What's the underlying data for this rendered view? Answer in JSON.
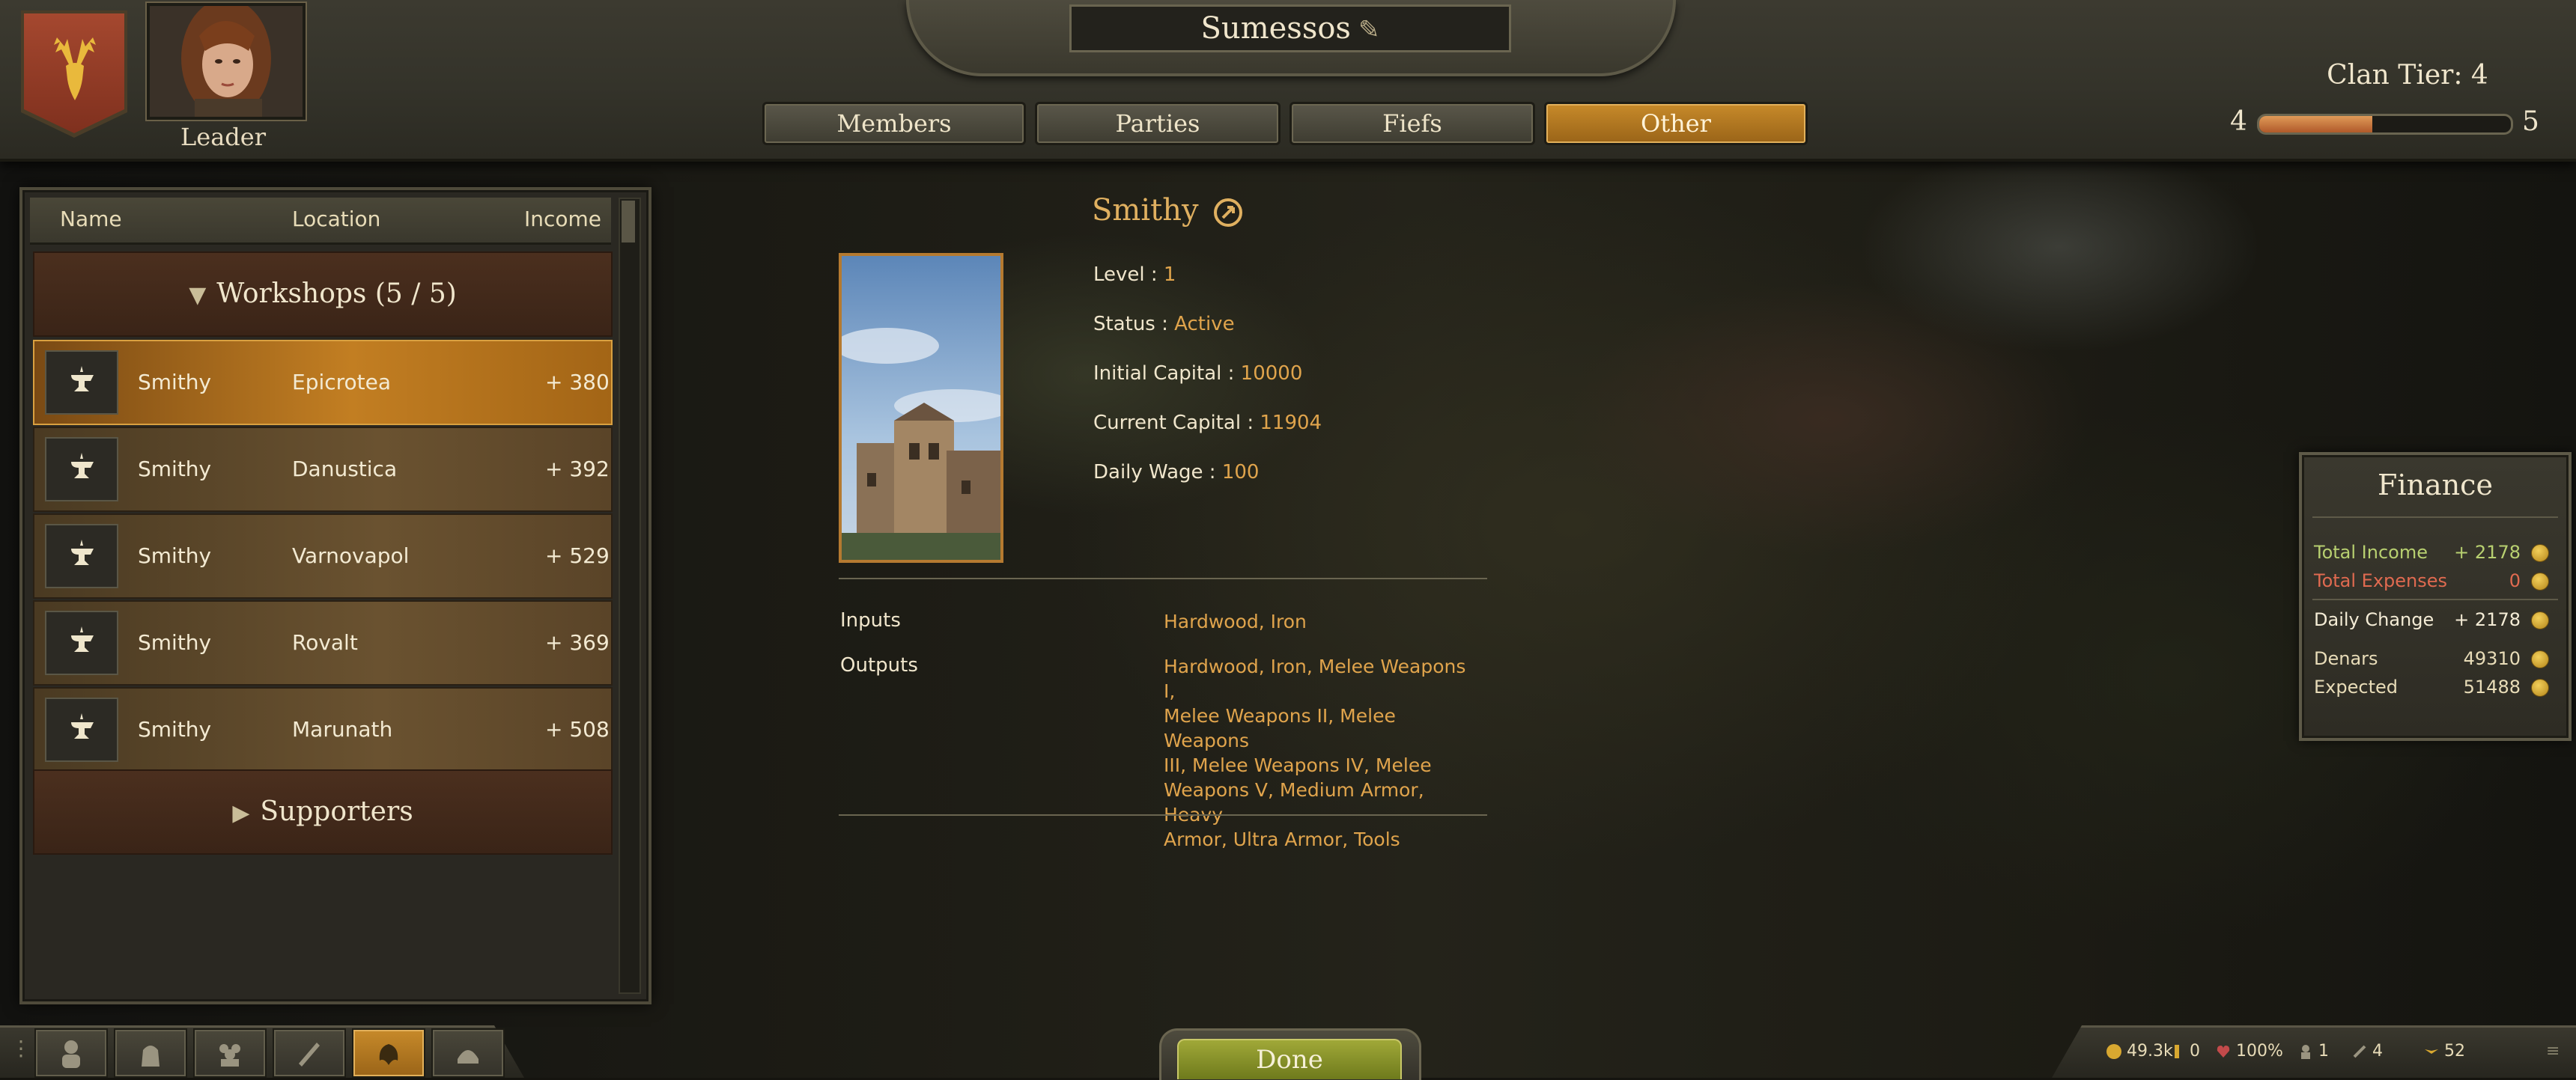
{
  "header": {
    "clan_name": "Sumessos",
    "leader_label": "Leader",
    "tabs": [
      "Members",
      "Parties",
      "Fiefs",
      "Other"
    ],
    "active_tab": "Other",
    "clan_tier_text": "Clan Tier: 4",
    "tier_min": "4",
    "tier_max": "5",
    "tier_progress": 0.45
  },
  "list": {
    "columns": {
      "name": "Name",
      "location": "Location",
      "income": "Income"
    },
    "workshops_group": "Workshops (5 / 5)",
    "items": [
      {
        "name": "Smithy",
        "location": "Epicrotea",
        "income": "+ 380",
        "selected": true
      },
      {
        "name": "Smithy",
        "location": "Danustica",
        "income": "+ 392",
        "selected": false
      },
      {
        "name": "Smithy",
        "location": "Varnovapol",
        "income": "+ 529",
        "selected": false
      },
      {
        "name": "Smithy",
        "location": "Rovalt",
        "income": "+ 369",
        "selected": false
      },
      {
        "name": "Smithy",
        "location": "Marunath",
        "income": "+ 508",
        "selected": false
      }
    ],
    "supporters_group": "Supporters"
  },
  "details": {
    "title": "Smithy",
    "level_label": "Level :",
    "level_value": "1",
    "status_label": "Status :",
    "status_value": "Active",
    "initial_capital_label": "Initial Capital :",
    "initial_capital_value": "10000",
    "current_capital_label": "Current Capital :",
    "current_capital_value": "11904",
    "daily_wage_label": "Daily Wage :",
    "daily_wage_value": "100",
    "inputs_label": "Inputs",
    "inputs_value": "Hardwood, Iron",
    "outputs_label": "Outputs",
    "outputs_lines": [
      "Hardwood, Iron, Melee Weapons I,",
      "Melee Weapons II, Melee Weapons",
      "III, Melee Weapons IV, Melee",
      "Weapons V, Medium Armor, Heavy",
      "Armor, Ultra Armor, Tools"
    ]
  },
  "finance": {
    "title": "Finance",
    "rows": [
      {
        "label": "Total Income",
        "value": "+ 2178",
        "color": "#b8d070"
      },
      {
        "label": "Total Expenses",
        "value": "0",
        "color": "#e06a50"
      },
      {
        "label": "Daily Change",
        "value": "+ 2178",
        "color": "#f4ecd6"
      },
      {
        "label": "Denars",
        "value": "49310",
        "color": "#e8dcb8"
      },
      {
        "label": "Expected",
        "value": "51488",
        "color": "#e8dcb8"
      }
    ]
  },
  "bottom": {
    "done_label": "Done",
    "nav_icons": [
      "character-icon",
      "inventory-icon",
      "party-icon",
      "quests-icon",
      "clan-icon",
      "kingdom-icon"
    ],
    "active_nav": "clan-icon",
    "status": {
      "gold": "49.3k",
      "influence": "0",
      "health": "100%",
      "troops": "1",
      "food": "4",
      "speed": "52"
    }
  },
  "colors": {
    "accent": "#c78a2a",
    "value_text": "#e0a44c",
    "done_button": "#8a9428"
  }
}
